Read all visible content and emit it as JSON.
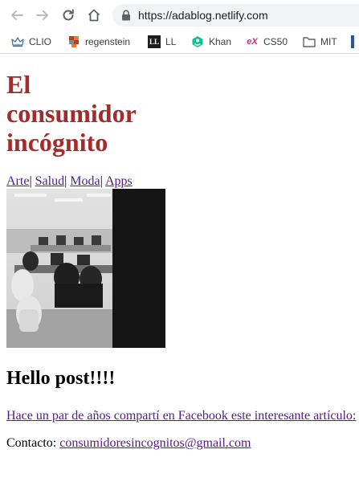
{
  "browser": {
    "url": "https://adablog.netlify.com",
    "bookmarks": [
      {
        "label": "CLIO",
        "icon": "crown-icon"
      },
      {
        "label": "regenstein",
        "icon": "regenstein-icon"
      },
      {
        "label": "LL",
        "icon": "ll-icon",
        "badge": "LL"
      },
      {
        "label": "Khan",
        "icon": "khan-icon"
      },
      {
        "label": "CS50",
        "icon": "edx-icon",
        "badge": "eX"
      },
      {
        "label": "MIT",
        "icon": "folder-icon"
      }
    ]
  },
  "page": {
    "title": "El consumidor incógnito",
    "title_color": "#a52a2a",
    "categories": [
      "Arte",
      "Salud",
      "Moda",
      "Apps"
    ],
    "separator": "|",
    "post_title": "Hello post!!!!",
    "post_link": "Hace un par de años compartí en Facebook este interesante artículo:",
    "contact_label": "Contacto:",
    "contact_email": "consumidoresincognitos@gmail.com"
  }
}
